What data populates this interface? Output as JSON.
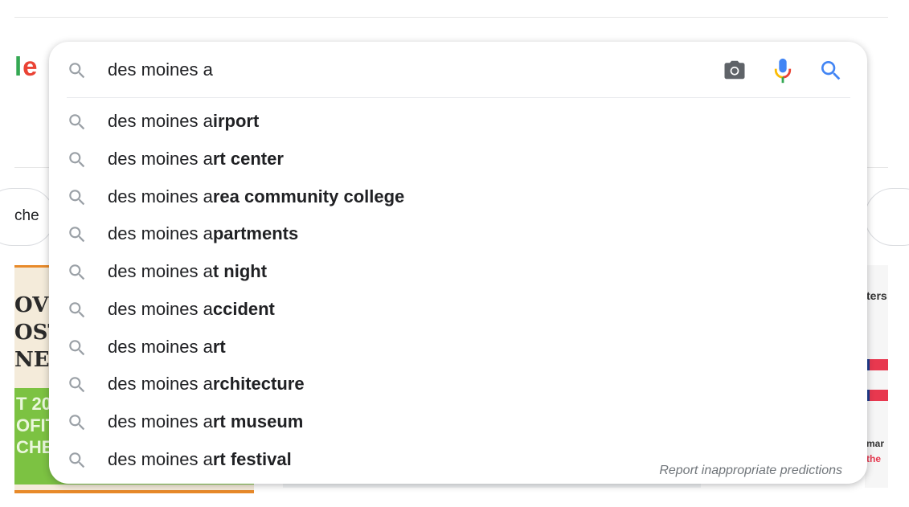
{
  "page": {
    "logo_l": "l",
    "logo_e": "e",
    "chip_label": "che"
  },
  "search": {
    "query": "des moines a",
    "report_link": "Report inappropriate predictions"
  },
  "suggestions": [
    {
      "prefix": "des moines a",
      "completion": "irport"
    },
    {
      "prefix": "des moines a",
      "completion": "rt center"
    },
    {
      "prefix": "des moines a",
      "completion": "rea community college"
    },
    {
      "prefix": "des moines a",
      "completion": "partments"
    },
    {
      "prefix": "des moines a",
      "completion": "t night"
    },
    {
      "prefix": "des moines a",
      "completion": "ccident"
    },
    {
      "prefix": "des moines a",
      "completion": "rt"
    },
    {
      "prefix": "des moines a",
      "completion": "rchitecture"
    },
    {
      "prefix": "des moines a",
      "completion": "rt museum"
    },
    {
      "prefix": "des moines a",
      "completion": "rt festival"
    }
  ],
  "background_ads": {
    "left_lines": [
      "OVI",
      "OSTI",
      "NE I"
    ],
    "left_green_lines": [
      "T 20",
      "OFIT",
      "CHES"
    ],
    "right_top": "ters",
    "right_bottom_1": "mar",
    "right_bottom_2": "the"
  },
  "colors": {
    "google_blue": "#4285f4",
    "google_red": "#ea4335",
    "google_yellow": "#fbbc05",
    "google_green": "#34a853",
    "icon_gray": "#9aa0a6"
  }
}
